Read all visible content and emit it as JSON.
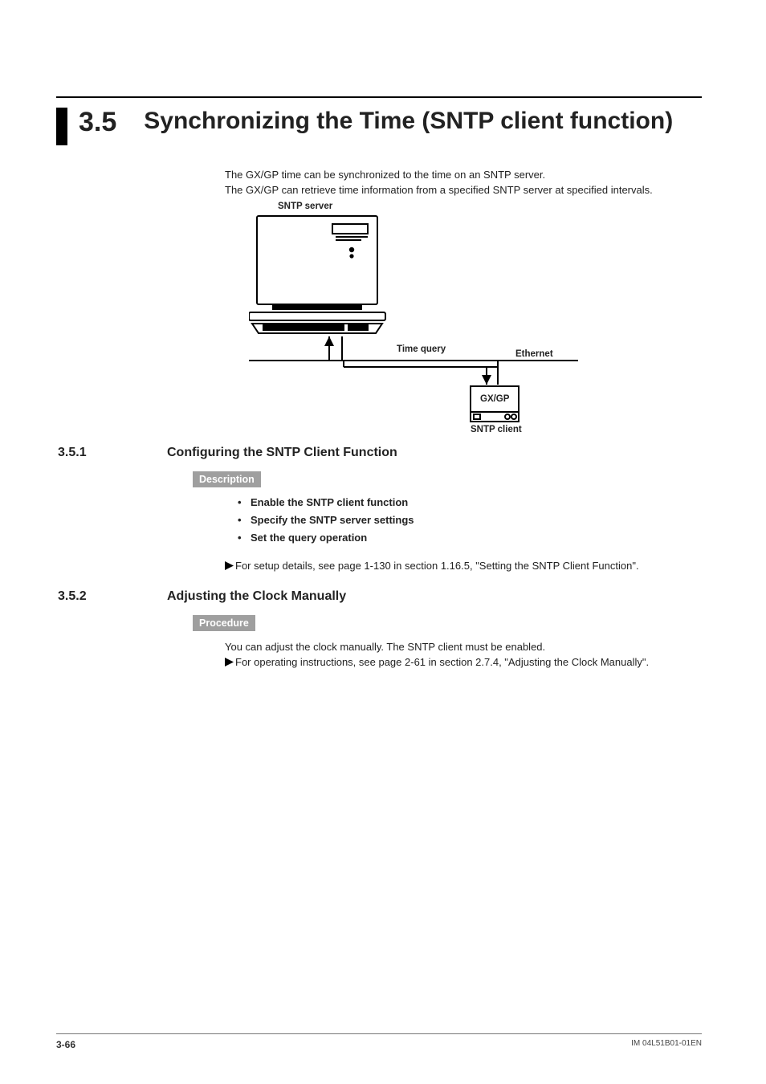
{
  "section": {
    "number": "3.5",
    "title": "Synchronizing the Time (SNTP client function)"
  },
  "intro": {
    "line1": "The GX/GP time can be synchronized to the time on an SNTP server.",
    "line2": "The GX/GP can retrieve time information from a specified SNTP server at specified intervals."
  },
  "diagram": {
    "sntp_server": "SNTP server",
    "time_query": "Time query",
    "ethernet": "Ethernet",
    "gxgp": "GX/GP",
    "sntp_client": "SNTP client"
  },
  "sub1": {
    "number": "3.5.1",
    "title": "Configuring the SNTP Client Function",
    "tag": "Description",
    "bullets": {
      "b1": "Enable the SNTP client function",
      "b2": "Specify the SNTP server settings",
      "b3": "Set the query operation"
    },
    "ref": "For setup details, see page 1-130 in section 1.16.5, \"Setting the SNTP Client Function\"."
  },
  "sub2": {
    "number": "3.5.2",
    "title": "Adjusting the Clock Manually",
    "tag": "Procedure",
    "line": "You can adjust the clock manually. The SNTP client must be enabled.",
    "ref": "For operating instructions, see page 2-61 in section 2.7.4, \"Adjusting the Clock Manually\"."
  },
  "footer": {
    "page": "3-66",
    "docid": "IM 04L51B01-01EN"
  }
}
